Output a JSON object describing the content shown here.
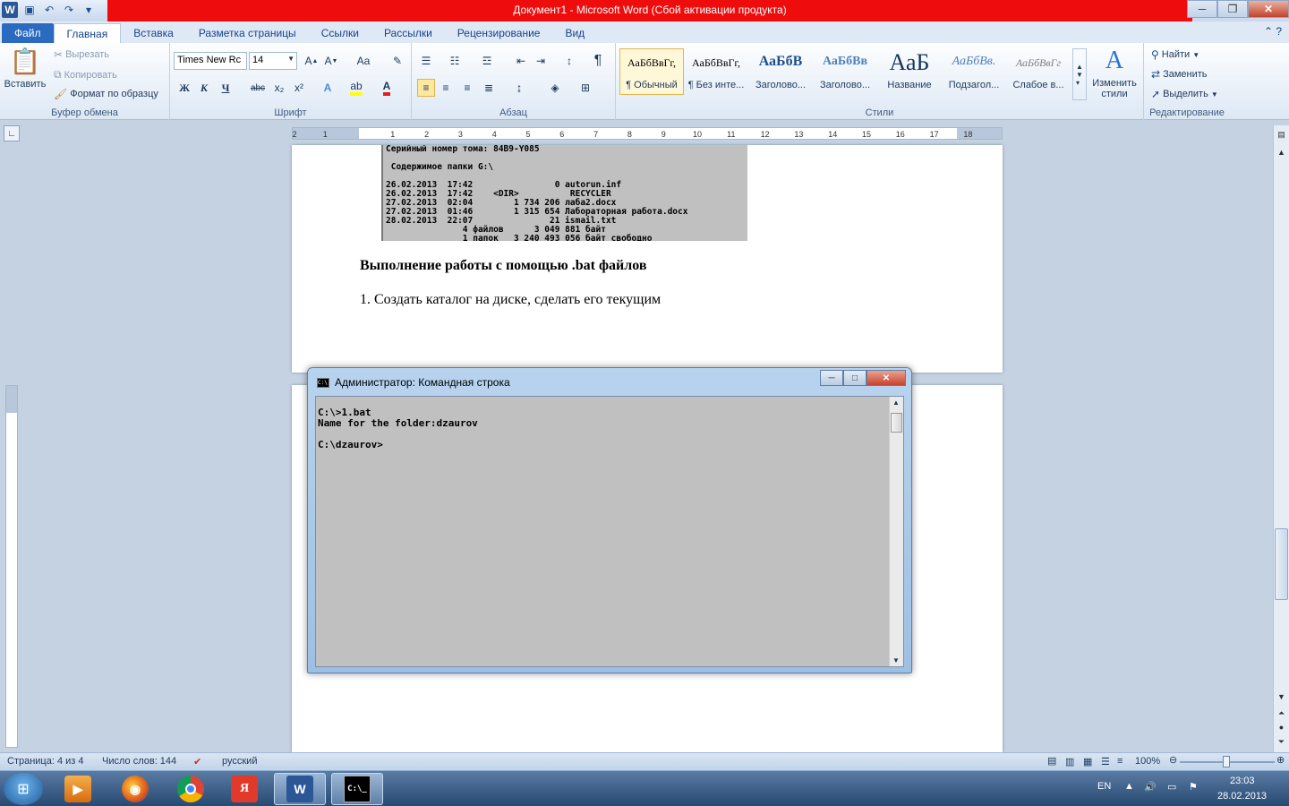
{
  "app": {
    "title": "Документ1 - Microsoft Word (Сбой активации продукта)"
  },
  "qat": {
    "word_icon": "W",
    "save_icon": "💾",
    "undo_icon": "↶",
    "redo_icon": "↷"
  },
  "tabs": [
    "Файл",
    "Главная",
    "Вставка",
    "Разметка страницы",
    "Ссылки",
    "Рассылки",
    "Рецензирование",
    "Вид"
  ],
  "ribbon": {
    "clipboard": {
      "paste": "Вставить",
      "cut": "Вырезать",
      "copy": "Копировать",
      "format_painter": "Формат по образцу",
      "label": "Буфер обмена"
    },
    "font": {
      "name": "Times New Rc",
      "size": "14",
      "label": "Шрифт",
      "bold": "Ж",
      "italic": "К",
      "underline": "Ч",
      "strike": "abc",
      "case": "Aa"
    },
    "paragraph": {
      "label": "Абзац",
      "pilcrow": "¶"
    },
    "styles": {
      "label": "Стили",
      "items": [
        {
          "sample": "АаБбВвГг,",
          "name": "¶ Обычный"
        },
        {
          "sample": "АаБбВвГг,",
          "name": "¶ Без инте..."
        },
        {
          "sample": "АаБбВ",
          "name": "Заголово..."
        },
        {
          "sample": "АаБбВв",
          "name": "Заголово..."
        },
        {
          "sample": "АаБ",
          "name": "Название"
        },
        {
          "sample": "АаБбВв.",
          "name": "Подзагол..."
        },
        {
          "sample": "АаБбВвГг",
          "name": "Слабое в..."
        }
      ],
      "change": "Изменить\nстили"
    },
    "editing": {
      "label": "Редактирование",
      "find": "Найти",
      "replace": "Заменить",
      "select": "Выделить"
    }
  },
  "ruler": {
    "numbers": [
      "2",
      "1",
      "1",
      "2",
      "3",
      "4",
      "5",
      "6",
      "7",
      "8",
      "9",
      "10",
      "11",
      "12",
      "13",
      "14",
      "15",
      "16",
      "17",
      "18"
    ]
  },
  "document": {
    "dos_lines": "Серийный номер тома: 84B9-Y085\n\n Содержимое папки G:\\\n\n26.02.2013  17:42                0 autorun.inf\n26.02.2013  17:42    <DIR>          RECYCLER\n27.02.2013  02:04        1 734 206 лаба2.docx\n27.02.2013  01:46        1 315 654 Лабораторная работа.docx\n28.02.2013  22:07               21 ismail.txt\n               4 файлов      3 049 881 байт\n               1 папок   3 240 493 056 байт свободно",
    "heading": "Выполнение работы с помощью .bat файлов",
    "item1": "1. Создать каталог на диске, сделать его текущим"
  },
  "cmd": {
    "title": "Администратор: Командная строка",
    "output": "C:\\>1.bat\nName for the folder:dzaurov\n\nC:\\dzaurov>"
  },
  "status": {
    "page": "Страница: 4 из 4",
    "words": "Число слов: 144",
    "language": "русский",
    "zoom": "100%"
  },
  "taskbar": {
    "lang": "EN",
    "time": "23:03",
    "date": "28.02.2013"
  }
}
